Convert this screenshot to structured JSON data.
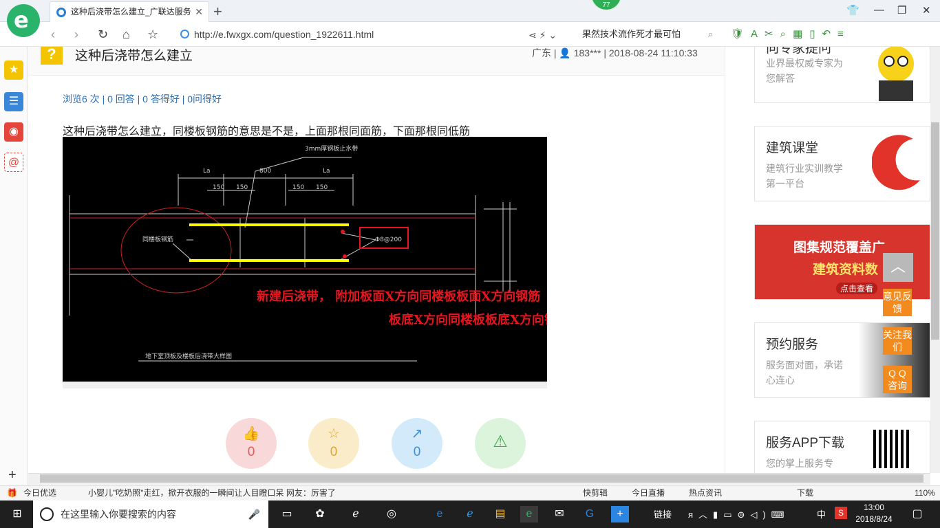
{
  "browser": {
    "tab_title": "这种后浇带怎么建立_广联达服务",
    "url": "http://e.fwxgx.com/question_1922611.html",
    "search_text": "果然技术流作死才最可怕",
    "notif_count": "77",
    "brand_color": "#2ab36a"
  },
  "question": {
    "title": "这种后浇带怎么建立",
    "meta": "广东 | 👤 183*** | 2018-08-24 11:10:33",
    "stats": "浏览6 次 | 0 回答 | 0 答得好 | 0问得好",
    "body": "这种后浇带怎么建立，同楼板钢筋的意思是不是，上面那根同面筋，下面那根同低筋"
  },
  "drawing": {
    "label_top": "3mm厚钢板止水带",
    "dim_la": "La",
    "dim_800": "800",
    "dim_150": "150",
    "left_label": "同楼板钢筋",
    "rebar_label": "Φ8@200",
    "caption": "地下室顶板及楼板后浇带大样图",
    "red_note_1": "新建后浇带，  附加板面X方向同楼板板面X方向钢筋",
    "red_note_2": "板底X方向同楼板板底X方向钢筋",
    "highlight_color": "#ffff00",
    "note_color": "#e8141e"
  },
  "actions": [
    {
      "name": "like",
      "icon": "👍",
      "count": "0",
      "bg": "#f8d8d8",
      "color": "#e05a5a"
    },
    {
      "name": "favorite",
      "icon": "☆",
      "count": "0",
      "bg": "#fbecc9",
      "color": "#e0a533"
    },
    {
      "name": "share",
      "icon": "↗",
      "count": "0",
      "bg": "#d3eafb",
      "color": "#3b8fd6"
    },
    {
      "name": "report",
      "icon": "⚠",
      "count": "",
      "bg": "#dcf4dc",
      "color": "#3fae4a"
    }
  ],
  "sidebar_cards": {
    "expert": {
      "title": "向专家提问",
      "sub": "业界最权威专家为您解答"
    },
    "course": {
      "title": "建筑课堂",
      "sub": "建筑行业实训教学第一平台"
    },
    "banner": {
      "line1": "图集规范覆盖广",
      "line2": "建筑资料数",
      "btn": "点击查看"
    },
    "service": {
      "title": "预约服务",
      "sub": "服务面对面，承诺心连心"
    },
    "app": {
      "title": "服务APP下载",
      "sub": "您的掌上服务专"
    }
  },
  "float_buttons": [
    "意见反馈",
    "关注我们",
    "Q Q 咨询"
  ],
  "statusbar": {
    "left_label": "今日优选",
    "headline": "小婴儿\"吃奶照\"走红，掀开衣服的一瞬间让人目瞪口呆 网友：厉害了",
    "items": [
      "快剪辑",
      "今日直播",
      "热点资讯",
      "下载"
    ],
    "zoom": "110%"
  },
  "taskbar": {
    "search_placeholder": "在这里输入你要搜索的内容",
    "links_label": "链接",
    "ime": "中",
    "time": "13:00",
    "date": "2018/8/24"
  }
}
